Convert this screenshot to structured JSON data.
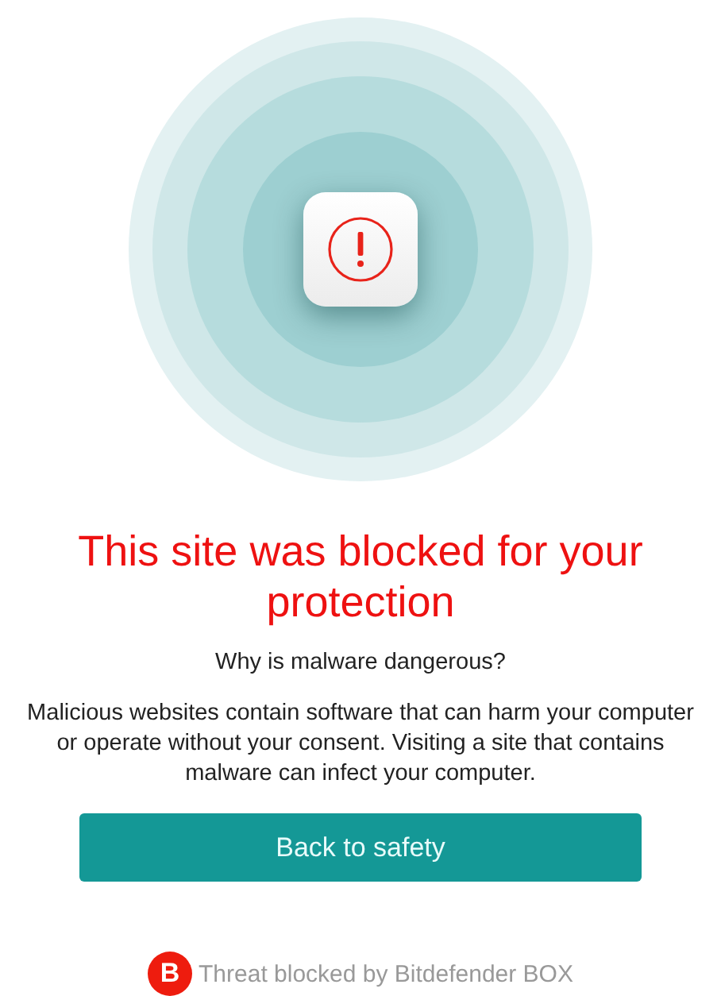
{
  "title": "This site was blocked for your protection",
  "subtitle": "Why is malware dangerous?",
  "description": "Malicious websites contain software that can harm your computer or operate without your consent. Visiting a site that contains malware can infect your computer.",
  "button": {
    "label": "Back to safety"
  },
  "footer": {
    "logo_letter": "B",
    "text": "Threat blocked by Bitdefender BOX"
  }
}
